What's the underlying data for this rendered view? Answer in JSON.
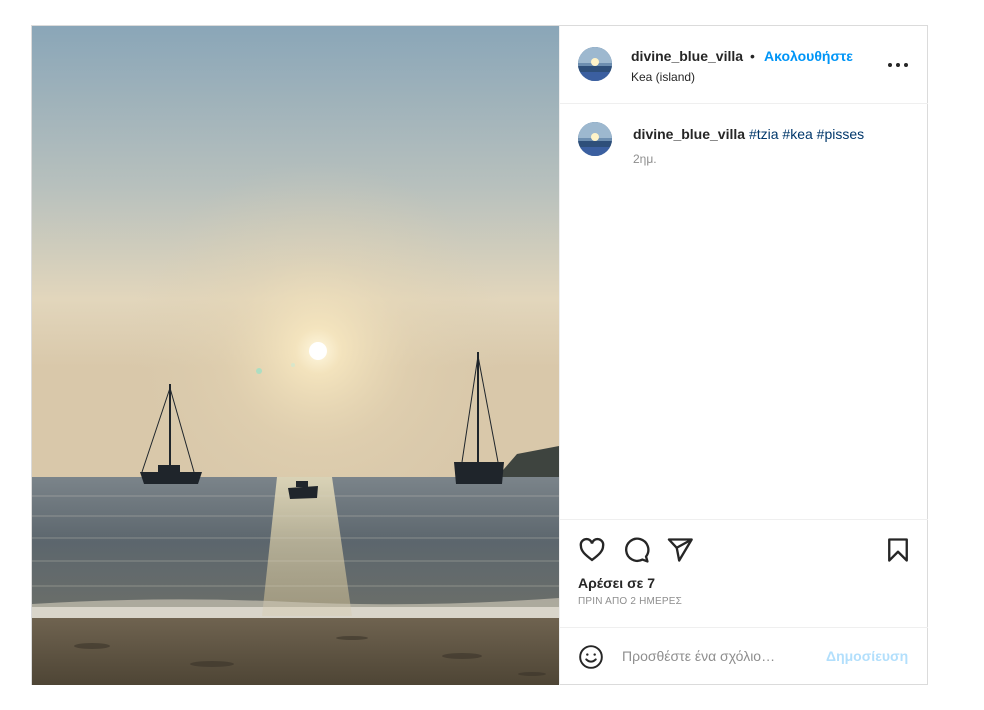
{
  "header": {
    "username": "divine_blue_villa",
    "separator": "•",
    "follow_label": "Ακολουθήστε",
    "location": "Kea (island)"
  },
  "caption": {
    "username": "divine_blue_villa",
    "hashtags": [
      "#tzia",
      "#kea",
      "#pisses"
    ],
    "time": "2ημ."
  },
  "actions": {
    "likes_text": "Αρέσει σε 7",
    "date_text": "ΠΡΙΝ ΑΠΟ 2 ΗΜΕΡΕΣ"
  },
  "comment": {
    "placeholder": "Προσθέστε ένα σχόλιο…",
    "post_label": "Δημοσίευση"
  },
  "icons": {
    "like": "heart-icon",
    "comment": "comment-bubble-icon",
    "share": "paper-plane-icon",
    "save": "bookmark-icon",
    "more": "more-options-icon",
    "emoji": "smiley-icon"
  },
  "colors": {
    "accent": "#0095f6",
    "hashtag": "#00376b",
    "muted": "#8e8e8e",
    "post_disabled": "#b2dffc"
  }
}
